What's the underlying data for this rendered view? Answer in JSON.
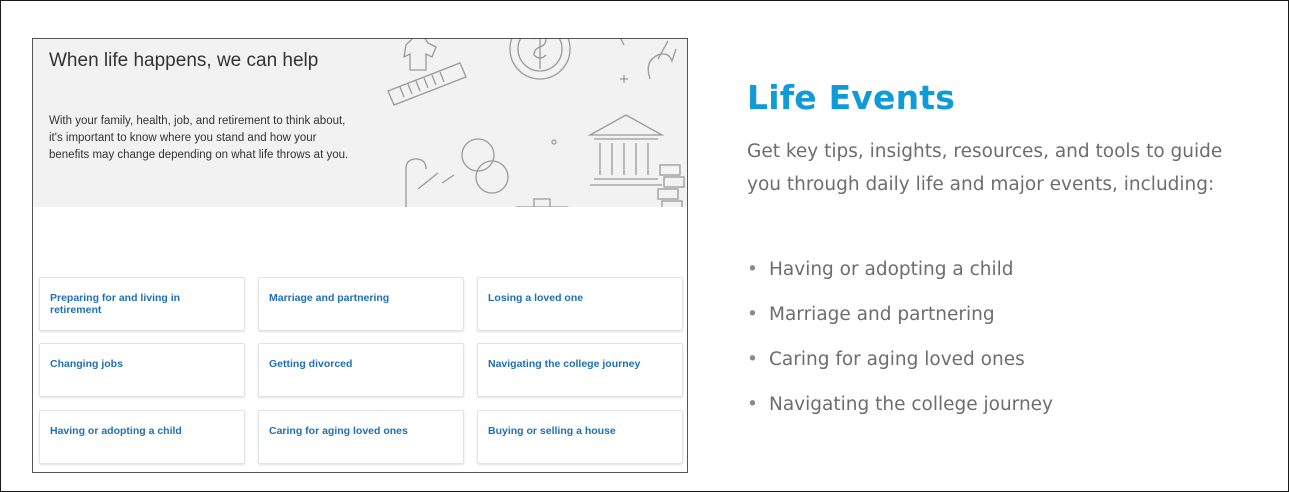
{
  "screenshot": {
    "hero": {
      "title": "When life happens, we can help",
      "text": "With your family, health, job, and retirement to think about, it's important to know where you stand and how your benefits may change depending on what life throws at you."
    },
    "tiles": [
      "Preparing for and living in retirement",
      "Marriage and partnering",
      "Losing a loved one",
      "Changing jobs",
      "Getting divorced",
      "Navigating the college journey",
      "Having or adopting a child",
      "Caring for aging loved ones",
      "Buying or selling a house"
    ]
  },
  "panel": {
    "title": "Life Events",
    "description": "Get key tips, insights, resources, and tools to guide you through daily life and major events, including:",
    "bullet_symbol": "•",
    "bullets": [
      "Having or adopting a child",
      "Marriage and partnering",
      "Caring for aging loved ones",
      "Navigating the college journey"
    ]
  },
  "colors": {
    "title_blue": "#0f9bd7",
    "link_blue": "#1f6fb5",
    "body_gray": "#6d6d6d",
    "hero_bg": "#f2f2f2"
  }
}
